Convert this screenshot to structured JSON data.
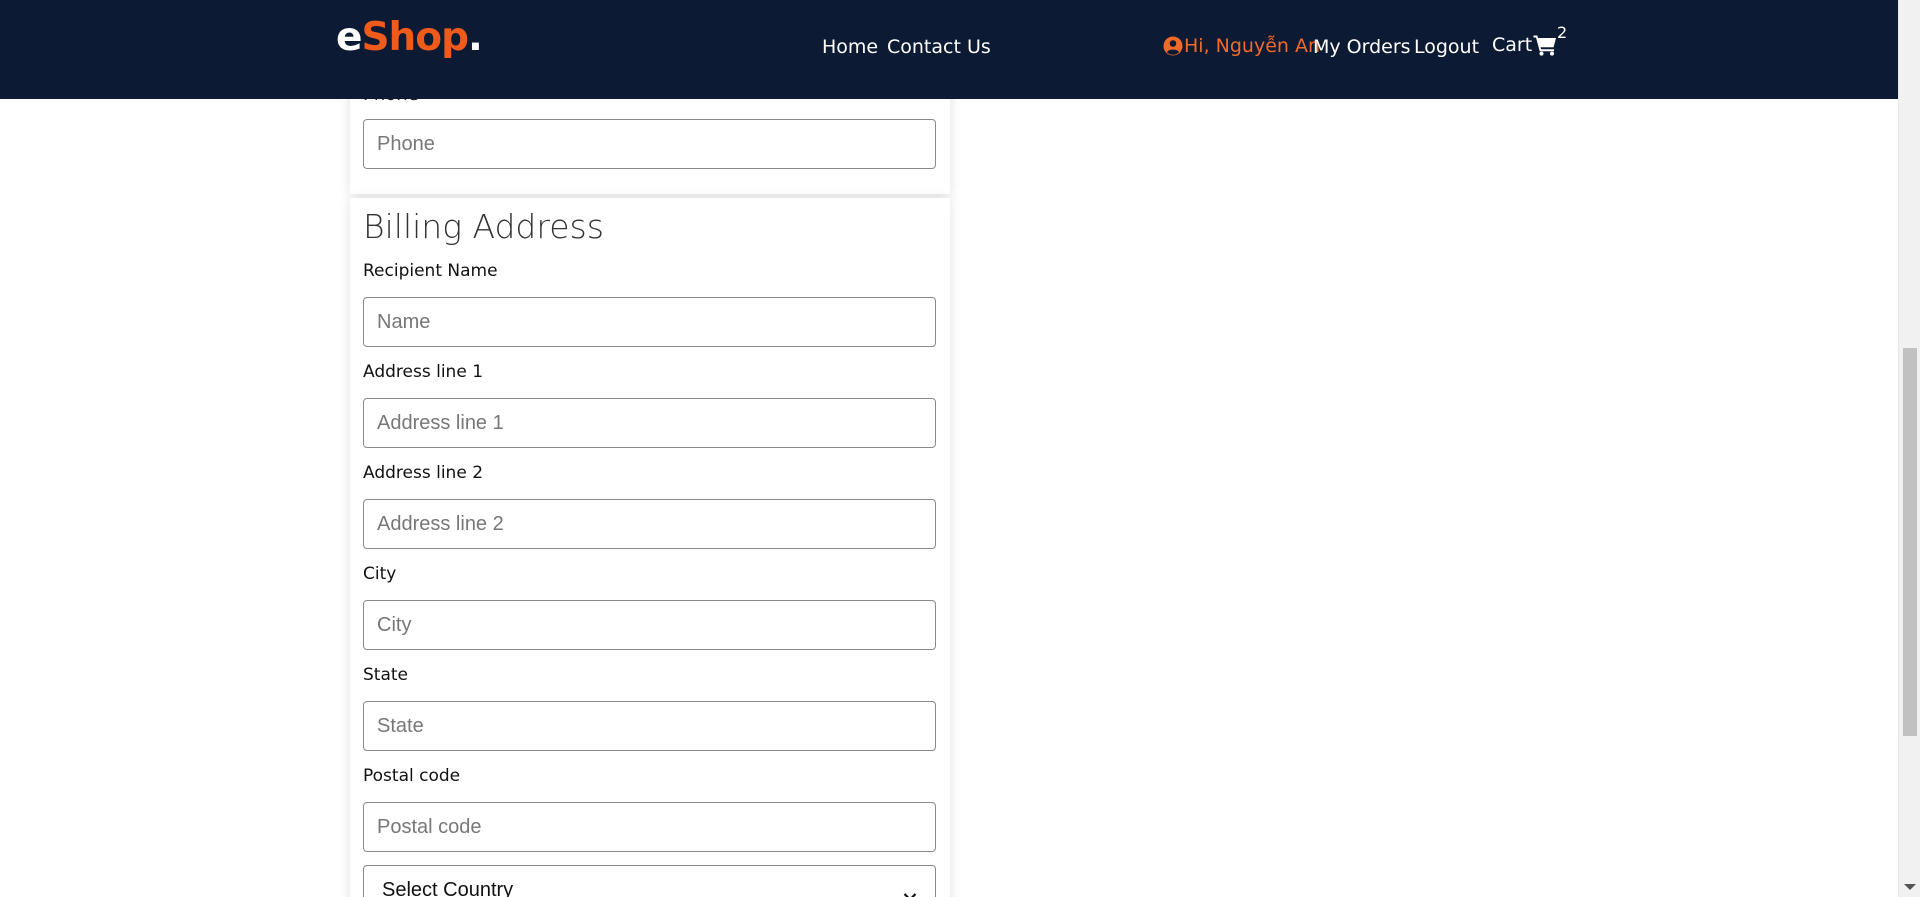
{
  "header": {
    "logo": {
      "part1": "e",
      "part2": "Shop",
      "part3": "."
    },
    "nav": {
      "home": "Home",
      "contact": "Contact Us"
    },
    "user": {
      "greeting": "Hi, Nguyễn An"
    },
    "my_orders": "My Orders",
    "logout": "Logout",
    "cart": {
      "label": "Cart",
      "count": "2"
    },
    "colors": {
      "background": "#0d1a33",
      "brand_accent": "#f05a1a",
      "user_accent": "#f26a2a"
    }
  },
  "phone_section": {
    "label": "Phone",
    "input": {
      "placeholder": "Phone",
      "value": ""
    }
  },
  "billing": {
    "title": "Billing Address",
    "fields": [
      {
        "label": "Recipient Name",
        "placeholder": "Name",
        "value": ""
      },
      {
        "label": "Address line 1",
        "placeholder": "Address line 1",
        "value": ""
      },
      {
        "label": "Address line 2",
        "placeholder": "Address line 2",
        "value": ""
      },
      {
        "label": "City",
        "placeholder": "City",
        "value": ""
      },
      {
        "label": "State",
        "placeholder": "State",
        "value": ""
      },
      {
        "label": "Postal code",
        "placeholder": "Postal code",
        "value": ""
      }
    ],
    "country_select": {
      "selected": "Select Country"
    }
  },
  "icons": {
    "user": "user-circle-icon",
    "cart": "shopping-cart-icon",
    "select": "chevron-down-icon"
  }
}
